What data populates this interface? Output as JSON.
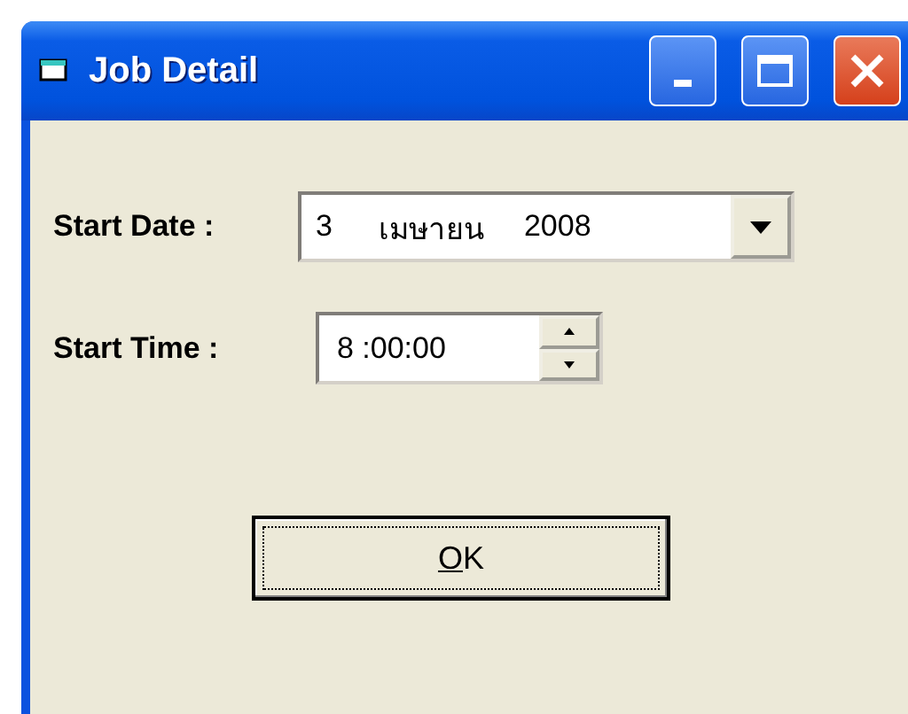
{
  "window": {
    "title": "Job Detail"
  },
  "start_date": {
    "label": "Start Date :",
    "day": "3",
    "month": "เมษายน",
    "year": "2008"
  },
  "start_time": {
    "label": "Start Time :",
    "value": "8 :00:00"
  },
  "buttons": [
    {
      "label": "OK",
      "focused": true
    }
  ]
}
